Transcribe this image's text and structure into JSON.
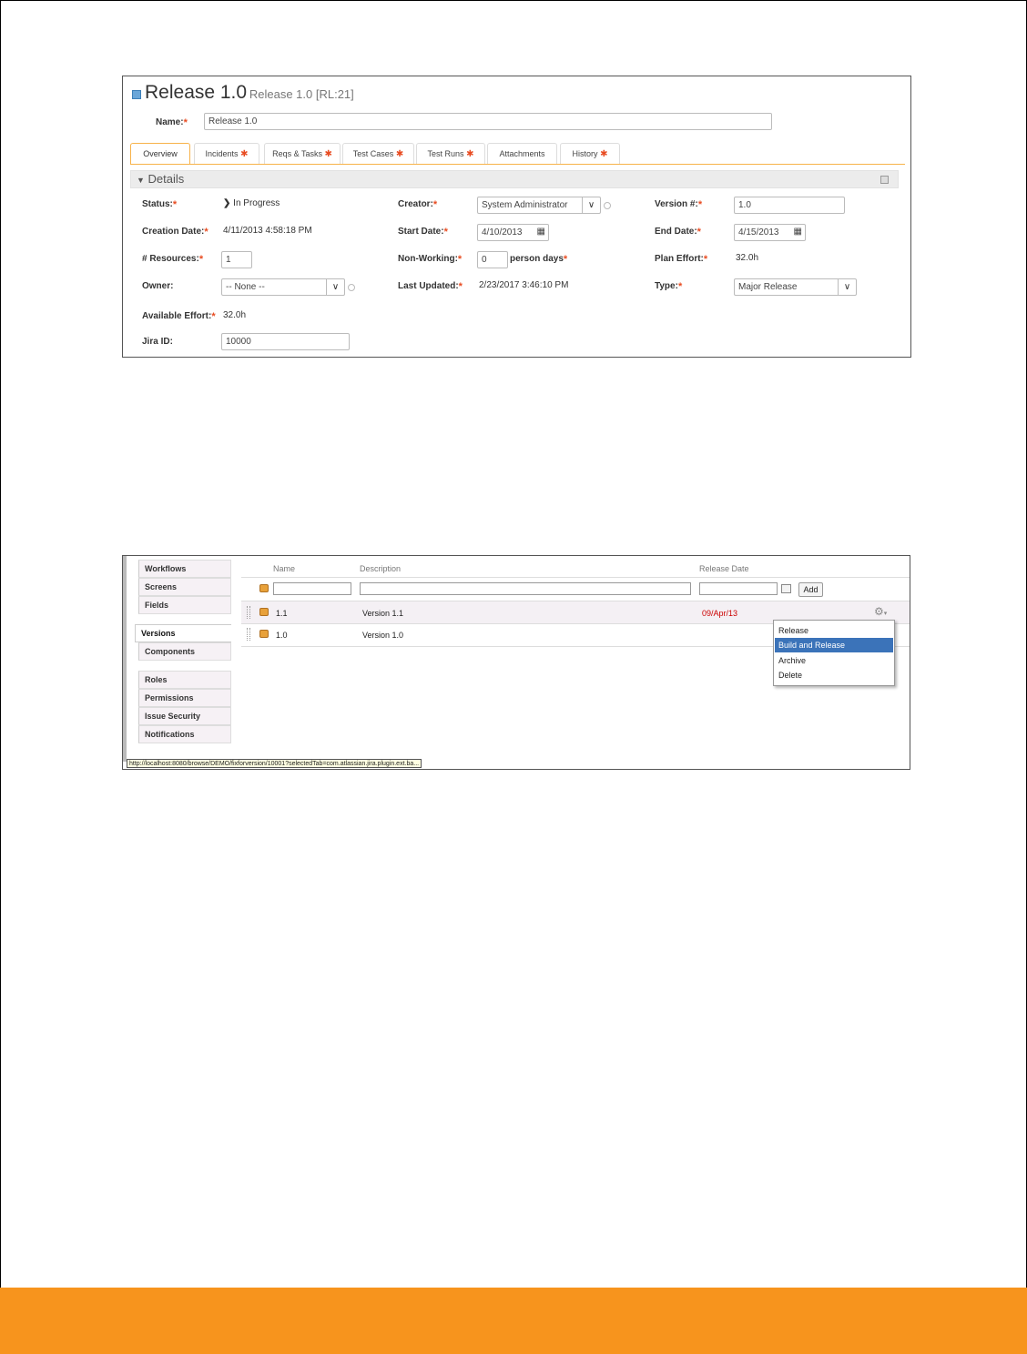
{
  "release_form": {
    "title": "Release 1.0",
    "subtitle": "Release 1.0 [RL:21]",
    "name_label": "Name:",
    "name_value": "Release 1.0",
    "required_mark": "*",
    "tabs": [
      {
        "label": "Overview",
        "star": ""
      },
      {
        "label": "Incidents",
        "star": "✱"
      },
      {
        "label": "Reqs & Tasks",
        "star": "✱"
      },
      {
        "label": "Test Cases",
        "star": "✱"
      },
      {
        "label": "Test Runs",
        "star": "✱"
      },
      {
        "label": "Attachments",
        "star": ""
      },
      {
        "label": "History",
        "star": "✱"
      }
    ],
    "details_label": "Details",
    "fields": {
      "status_label": "Status:",
      "status_value": "In Progress",
      "creation_date_label": "Creation Date:",
      "creation_date_value": "4/11/2013 4:58:18 PM",
      "resources_label": "# Resources:",
      "resources_value": "1",
      "owner_label": "Owner:",
      "owner_value": "-- None --",
      "available_effort_label": "Available Effort:",
      "available_effort_value": "32.0h",
      "jira_id_label": "Jira ID:",
      "jira_id_value": "10000",
      "creator_label": "Creator:",
      "creator_value": "System Administrator",
      "start_date_label": "Start Date:",
      "start_date_value": "4/10/2013",
      "non_working_label": "Non-Working:",
      "non_working_value": "0",
      "person_days_label": "person days",
      "last_updated_label": "Last Updated:",
      "last_updated_value": "2/23/2017 3:46:10 PM",
      "version_label": "Version #:",
      "version_value": "1.0",
      "end_date_label": "End Date:",
      "end_date_value": "4/15/2013",
      "plan_effort_label": "Plan Effort:",
      "plan_effort_value": "32.0h",
      "type_label": "Type:",
      "type_value": "Major Release"
    }
  },
  "jira_versions": {
    "nav_items": [
      "Workflows",
      "Screens",
      "Fields",
      "Versions",
      "Components",
      "Roles",
      "Permissions",
      "Issue Security",
      "Notifications"
    ],
    "columns": {
      "name": "Name",
      "description": "Description",
      "release_date": "Release Date"
    },
    "add_button": "Add",
    "rows": [
      {
        "name": "1.1",
        "description": "Version 1.1",
        "release_date": "09/Apr/13"
      },
      {
        "name": "1.0",
        "description": "Version 1.0",
        "release_date": ""
      }
    ],
    "menu_items": [
      "Release",
      "Build and Release",
      "Archive",
      "Delete"
    ],
    "status_url": "http://localhost:8080/browse/DEMO/fixforversion/10001?selectedTab=com.atlassian.jira.plugin.ext.ba..."
  },
  "colors": {
    "accent": "#f7941d",
    "required": "#e84c22",
    "menu_highlight": "#3b73b9",
    "overdue_date": "#cc0000"
  }
}
